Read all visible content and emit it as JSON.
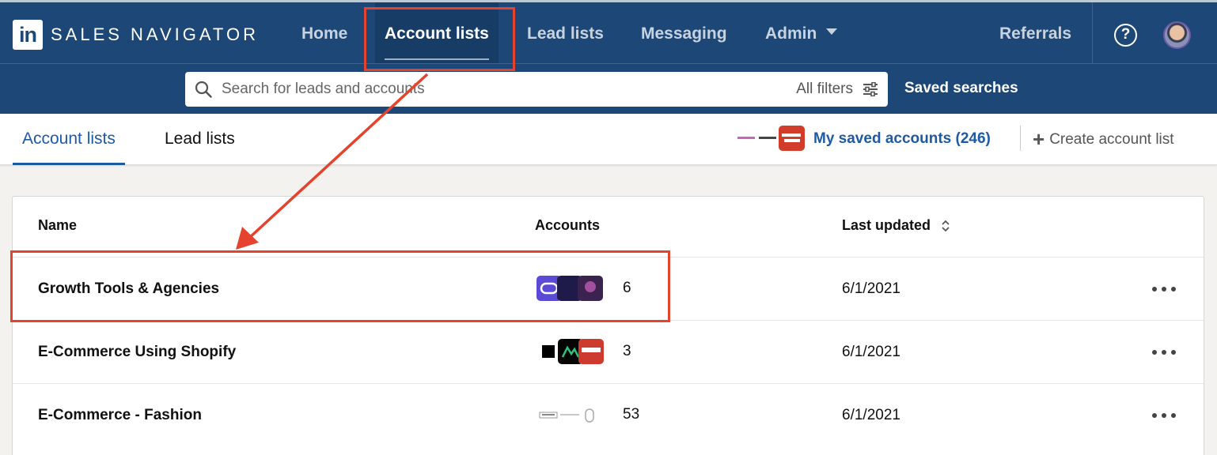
{
  "brand": {
    "logo_letters": "in",
    "name": "SALES NAVIGATOR"
  },
  "nav": {
    "items": [
      {
        "label": "Home"
      },
      {
        "label": "Account lists"
      },
      {
        "label": "Lead lists"
      },
      {
        "label": "Messaging"
      },
      {
        "label": "Admin"
      }
    ],
    "referrals": "Referrals",
    "help": "?"
  },
  "search": {
    "placeholder": "Search for leads and accounts",
    "filters_label": "All filters",
    "saved_searches": "Saved searches"
  },
  "subnav": {
    "tabs": [
      {
        "label": "Account lists"
      },
      {
        "label": "Lead lists"
      }
    ],
    "saved_accounts": "My saved accounts (246)",
    "create_list": "Create account list"
  },
  "table": {
    "headers": {
      "name": "Name",
      "accounts": "Accounts",
      "last_updated": "Last updated"
    },
    "rows": [
      {
        "name": "Growth Tools & Agencies",
        "count": "6",
        "date": "6/1/2021"
      },
      {
        "name": "E-Commerce Using Shopify",
        "count": "3",
        "date": "6/1/2021"
      },
      {
        "name": "E-Commerce - Fashion",
        "count": "53",
        "date": "6/1/2021"
      }
    ]
  },
  "colors": {
    "nav_bg": "#1d4777",
    "link": "#1d5aa6",
    "annotation": "#e5432d"
  }
}
